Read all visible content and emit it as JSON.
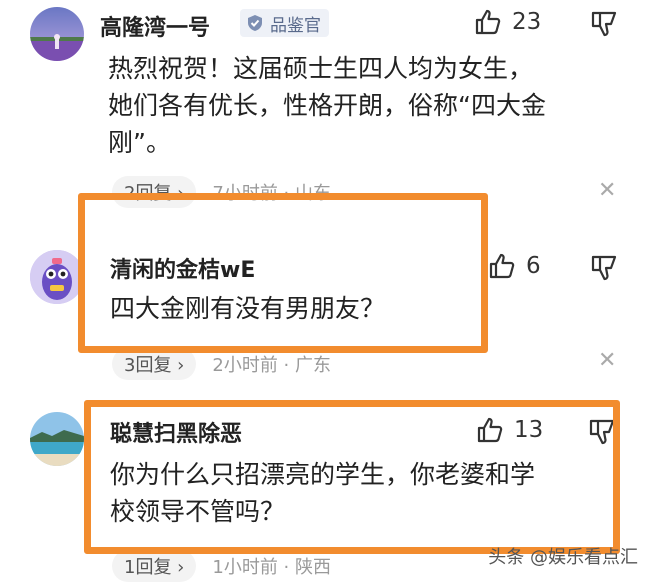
{
  "comments": [
    {
      "username": "高隆湾一号",
      "badge": "品鉴官",
      "likes": "23",
      "text_lines": [
        "热烈祝贺！这届硕士生四人均为女生，",
        "她们各有优长，性格开朗，俗称“四大金",
        "刚”。"
      ],
      "replies": "2回复",
      "time_location": "7小时前 · 山东"
    },
    {
      "username": "清闲的金桔wE",
      "likes": "6",
      "text_lines": [
        "四大金刚有没有男朋友？"
      ],
      "replies": "3回复",
      "time_location": "2小时前 · 广东"
    },
    {
      "username": "聪慧扫黑除恶",
      "likes": "13",
      "text_lines": [
        "你为什么只招漂亮的学生，你老婆和学",
        "校领导不管吗？"
      ],
      "replies": "1回复",
      "time_location": "1小时前 · 陕西"
    }
  ],
  "watermark": "头条 @娱乐看点汇",
  "colors": {
    "highlight_frame": "#f28c2e",
    "badge_text": "#596a8c",
    "meta_text": "#9a9a9a"
  },
  "icons": {
    "like": "thumbs-up-icon",
    "dislike": "thumbs-down-icon",
    "badge": "shield-icon",
    "dismiss": "close-icon"
  }
}
